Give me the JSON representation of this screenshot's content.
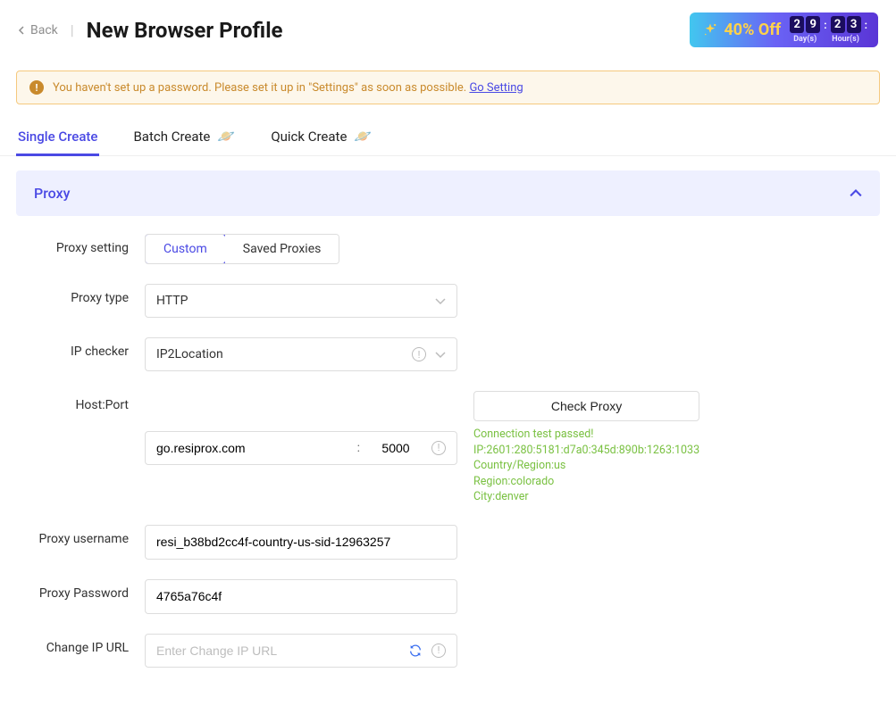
{
  "header": {
    "back_label": "Back",
    "title": "New Browser Profile"
  },
  "promo": {
    "text": "40% Off",
    "days_d1": "2",
    "days_d2": "9",
    "hours_d1": "2",
    "hours_d2": "3",
    "days_label": "Day(s)",
    "hours_label": "Hour(s)"
  },
  "alert": {
    "text": "You haven't set up a password. Please set it up in \"Settings\" as soon as possible. ",
    "link_text": "Go Setting"
  },
  "tabs": {
    "single": "Single Create",
    "batch": "Batch Create",
    "quick": "Quick Create"
  },
  "panel": {
    "title": "Proxy"
  },
  "form": {
    "proxy_setting_label": "Proxy setting",
    "proxy_setting_custom": "Custom",
    "proxy_setting_saved": "Saved Proxies",
    "proxy_type_label": "Proxy type",
    "proxy_type_value": "HTTP",
    "ip_checker_label": "IP checker",
    "ip_checker_value": "IP2Location",
    "hostport_label": "Host:Port",
    "host_value": "go.resiprox.com",
    "port_value": "5000",
    "check_proxy_label": "Check Proxy",
    "proxy_username_label": "Proxy username",
    "proxy_username_value": "resi_b38bd2cc4f-country-us-sid-12963257",
    "proxy_password_label": "Proxy Password",
    "proxy_password_value": "4765a76c4f",
    "change_ip_label": "Change IP URL",
    "change_ip_placeholder": "Enter Change IP URL"
  },
  "check_result": {
    "line1": "Connection test passed!",
    "line2": "IP:2601:280:5181:d7a0:345d:890b:1263:1033",
    "line3": "Country/Region:us",
    "line4": "Region:colorado",
    "line5": "City:denver"
  }
}
